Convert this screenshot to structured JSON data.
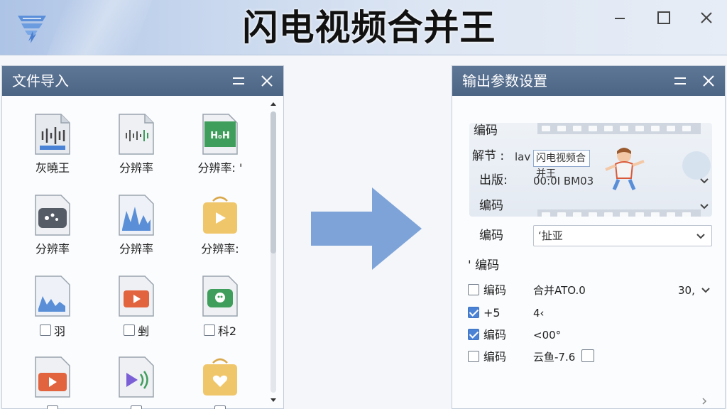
{
  "app": {
    "title": "闪电视频合并王",
    "accent_color": "#4d6585",
    "logo_icon": "lightning-funnel-logo"
  },
  "window_controls": [
    "minimize-icon",
    "maximize-icon",
    "close-icon"
  ],
  "left_panel": {
    "title": "文件导入",
    "header_buttons": [
      "collapse-icon",
      "close-icon"
    ],
    "files": [
      {
        "label": "灰曉王",
        "icon": "audio-file-icon",
        "checkbox": false
      },
      {
        "label": "分辨率",
        "icon": "audio-file-icon",
        "checkbox": false
      },
      {
        "label": "分辨率: '",
        "icon": "image-file-icon",
        "checkbox": false
      },
      {
        "label": "分辨率",
        "icon": "video-file-icon",
        "checkbox": false
      },
      {
        "label": "分辨率",
        "icon": "waveform-file-icon",
        "checkbox": false
      },
      {
        "label": "分辨率:",
        "icon": "folder-play-icon",
        "checkbox": false
      },
      {
        "label": "羽",
        "icon": "waveform-file-icon",
        "checkbox": true,
        "checked": false
      },
      {
        "label": "剉",
        "icon": "video-file-icon",
        "checkbox": true,
        "checked": false
      },
      {
        "label": "科2",
        "icon": "green-chat-file-icon",
        "checkbox": true,
        "checked": false
      },
      {
        "label": "",
        "icon": "video-file-icon",
        "checkbox": false
      },
      {
        "label": "",
        "icon": "audio-play-file-icon",
        "checkbox": false
      },
      {
        "label": "",
        "icon": "folder-heart-icon",
        "checkbox": false
      }
    ]
  },
  "right_panel": {
    "title": "输出参数设置",
    "header_buttons": [
      "collapse-icon",
      "close-icon"
    ],
    "preview": {
      "label_top": "编码",
      "row1_label": "解节 :",
      "row1_value": "lav",
      "row1_input": "闪电视频合并王",
      "row2_label": "出版:",
      "row2_value": "00:0I  BM03",
      "row3_label": "编码"
    },
    "codec_label": "编码",
    "codec_select": "‘扯亚",
    "section_label": "' 编码",
    "options": [
      {
        "label": "编码",
        "value": "合并ATO.0",
        "checked": false,
        "extra": "30,",
        "extra_dropdown": true
      },
      {
        "label": "+5",
        "value": "4‹",
        "checked": true
      },
      {
        "label": "编码",
        "value": "<00°",
        "checked": true
      },
      {
        "label": "编码",
        "value": "云鱼-7.6",
        "checked": false,
        "trailing_checkbox": true
      }
    ]
  }
}
